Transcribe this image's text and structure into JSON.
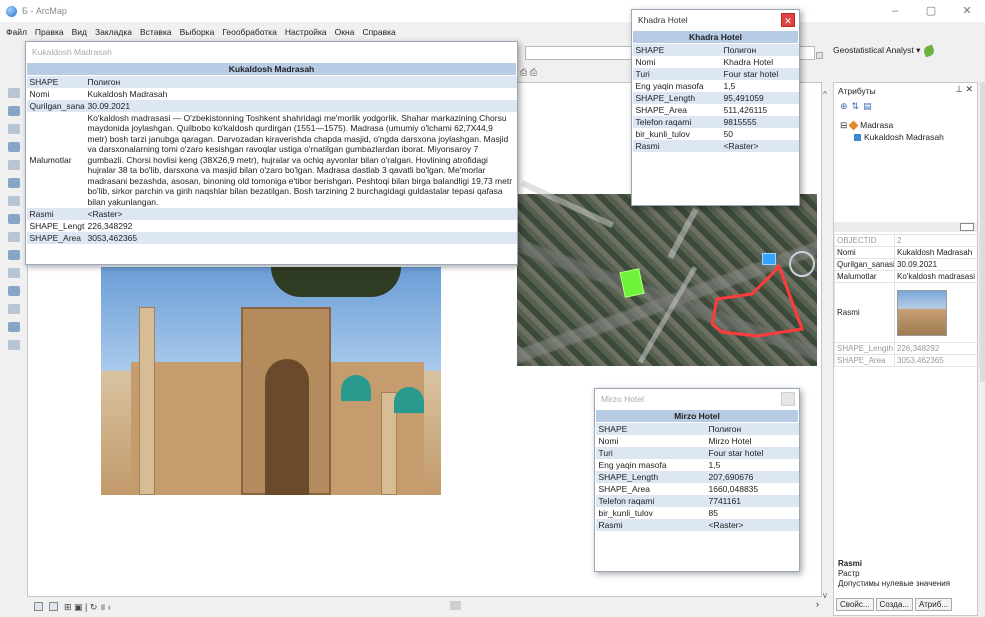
{
  "window": {
    "title": "Б - ArcMap",
    "minimize": "–",
    "maximize": "▢",
    "close": "✕"
  },
  "menu": [
    "Файл",
    "Правка",
    "Вид",
    "Закладка",
    "Вставка",
    "Выборка",
    "Геообработка",
    "Настройка",
    "Окна",
    "Справка"
  ],
  "toolbar": {
    "geostatistical": "Geostatistical Analyst ▾"
  },
  "status": {
    "left": "⊞ ▣ | ↻ ॥ ‹",
    "right": "›"
  },
  "kukaldosh_popup": {
    "title": "Kukaldosh Madrasah",
    "header": "Kukaldosh Madrasah",
    "rows": [
      {
        "k": "SHAPE",
        "v": "Полигон"
      },
      {
        "k": "Nomi",
        "v": "Kukaldosh Madrasah"
      },
      {
        "k": "Qurilgan_sanasi",
        "v": "30.09.2021"
      },
      {
        "k": "Malumotlar",
        "v": "Ko'kaldosh madrasasi — O'zbekistonning Toshkent shahridagi me'morlik yodgorlik. Shahar markazining Chorsu maydonida joylashgan. Quilbobo ko'kaldosh qurdirgan (1551—1575). Madrasa (umumiy o'lchami 62,7X44,9 metr) bosh tarzi janubga qaragan. Darvozadan kiraverishda chapda masjid, o'ngda darsxona joylashgan. Masjid va darsxonalarning tomi o'zaro kesishgan ravoqlar ustiga o'rnatilgan gumbazlardan iborat. Miyonsaroy 7 gumbazli. Chorsi hovlisi keng (38X26,9 metr), hujralar va ochiq ayvonlar bilan o'ralgan. Hovlining atrofidagi hujralar 38 ta bo'lib, darsxona va masjid bilan o'zaro bo'lgan. Madrasa dastlab 3 qavatli bo'lgan. Me'morlar madrasani bezashda, asosan, binoning old tomoniga e'tibor berishgan. Peshtoqi bilan birga balandligi 19,73 metr bo'lib, sirkor parchin va girih naqshlar bilan bezatilgan. Bosh tarzining 2 burchagidagi guldastalar tepasi qafasa bilan yakunlangan."
      },
      {
        "k": "Rasmi",
        "v": "<Raster>"
      },
      {
        "k": "SHAPE_Length",
        "v": "226,348292"
      },
      {
        "k": "SHAPE_Area",
        "v": "3053,462365"
      }
    ]
  },
  "khadra_popup": {
    "title": "Khadra Hotel",
    "header": "Khadra Hotel",
    "close": "✕",
    "rows": [
      {
        "k": "SHAPE",
        "v": "Полигон"
      },
      {
        "k": "Nomi",
        "v": "Khadra Hotel"
      },
      {
        "k": "Turi",
        "v": "Four star hotel"
      },
      {
        "k": "Eng yaqin masofa",
        "v": "1,5"
      },
      {
        "k": "SHAPE_Length",
        "v": "95,491059"
      },
      {
        "k": "SHAPE_Area",
        "v": "511,426115"
      },
      {
        "k": "Telefon raqami",
        "v": "9815555"
      },
      {
        "k": "bir_kunli_tulov",
        "v": "50"
      },
      {
        "k": "Rasmi",
        "v": "<Raster>"
      }
    ]
  },
  "mirzo_popup": {
    "title": "Mirzo Hotel",
    "header": "Mirzo Hotel",
    "rows": [
      {
        "k": "SHAPE",
        "v": "Полигон"
      },
      {
        "k": "Nomi",
        "v": "Mirzo Hotel"
      },
      {
        "k": "Turi",
        "v": "Four star hotel"
      },
      {
        "k": "Eng yaqin masofa",
        "v": "1,5"
      },
      {
        "k": "SHAPE_Length",
        "v": "207,690676"
      },
      {
        "k": "SHAPE_Area",
        "v": "1660,048835"
      },
      {
        "k": "Telefon raqami",
        "v": "7741161"
      },
      {
        "k": "bir_kunli_tulov",
        "v": "85"
      },
      {
        "k": "Rasmi",
        "v": "<Raster>"
      }
    ]
  },
  "attributes": {
    "title": "Атрибуты",
    "controls": "⊥ ✕",
    "tree_parent": "Madrasa",
    "tree_child": "Kukaldosh Madrasah",
    "rows": [
      {
        "k": "OBJECTID",
        "v": "2",
        "grey": true
      },
      {
        "k": "Nomi",
        "v": "Kukaldosh Madrasah",
        "grey": false
      },
      {
        "k": "Qurilgan_sanasi",
        "v": "30.09.2021",
        "grey": false
      },
      {
        "k": "Malumotlar",
        "v": "Ko'kaldosh madrasasi",
        "grey": false
      },
      {
        "k": "Rasmi",
        "v": "",
        "grey": false
      },
      {
        "k": "SHAPE_Length",
        "v": "226,348292",
        "grey": true
      },
      {
        "k": "SHAPE_Area",
        "v": "3053,462365",
        "grey": true
      }
    ],
    "field_name": "Rasmi",
    "field_type": "Растр",
    "field_null": "Допустимы нулевые значения",
    "tabs": [
      "Свойс...",
      "Созда...",
      "Атриб..."
    ]
  }
}
